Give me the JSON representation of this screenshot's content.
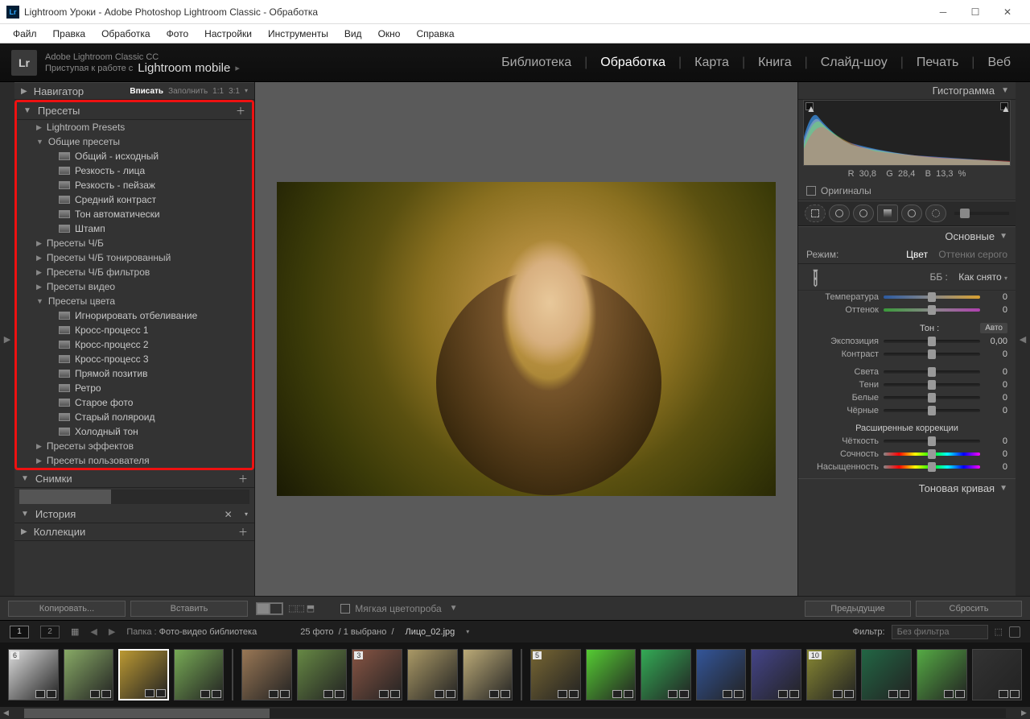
{
  "window": {
    "title": "Lightroom Уроки - Adobe Photoshop Lightroom Classic - Обработка"
  },
  "menu": [
    "Файл",
    "Правка",
    "Обработка",
    "Фото",
    "Настройки",
    "Инструменты",
    "Вид",
    "Окно",
    "Справка"
  ],
  "identity": {
    "line1": "Adobe Lightroom Classic CC",
    "line2a": "Приступая к работе с",
    "line2b": "Lightroom mobile"
  },
  "modules": [
    "Библиотека",
    "Обработка",
    "Карта",
    "Книга",
    "Слайд-шоу",
    "Печать",
    "Веб"
  ],
  "active_module": "Обработка",
  "left": {
    "navigator": {
      "title": "Навигатор",
      "fit": "Вписать",
      "fill": "Заполнить",
      "z1": "1:1",
      "z3": "3:1"
    },
    "presets": {
      "title": "Пресеты",
      "groups": [
        {
          "title": "Lightroom Presets",
          "expanded": false
        },
        {
          "title": "Общие пресеты",
          "expanded": true,
          "items": [
            "Общий - исходный",
            "Резкость - лица",
            "Резкость - пейзаж",
            "Средний контраст",
            "Тон автоматически",
            "Штамп"
          ]
        },
        {
          "title": "Пресеты Ч/Б",
          "expanded": false
        },
        {
          "title": "Пресеты Ч/Б тонированный",
          "expanded": false
        },
        {
          "title": "Пресеты Ч/Б фильтров",
          "expanded": false
        },
        {
          "title": "Пресеты видео",
          "expanded": false
        },
        {
          "title": "Пресеты цвета",
          "expanded": true,
          "items": [
            "Игнорировать отбеливание",
            "Кросс-процесс 1",
            "Кросс-процесс 2",
            "Кросс-процесс 3",
            "Прямой позитив",
            "Ретро",
            "Старое фото",
            "Старый поляроид",
            "Холодный тон"
          ]
        },
        {
          "title": "Пресеты эффектов",
          "expanded": false
        },
        {
          "title": "Пресеты пользователя",
          "expanded": false
        }
      ]
    },
    "snapshots": "Снимки",
    "history": "История",
    "collections": "Коллекции"
  },
  "right": {
    "histogram": "Гистограмма",
    "rgb": {
      "r_label": "R",
      "r": "30,8",
      "g_label": "G",
      "g": "28,4",
      "b_label": "B",
      "b": "13,3",
      "pct": "%"
    },
    "originals": "Оригиналы",
    "basic": {
      "title": "Основные",
      "mode_label": "Режим:",
      "mode_color": "Цвет",
      "mode_gray": "Оттенки серого",
      "wb_label": "ББ :",
      "wb_value": "Как снято",
      "temp": "Температура",
      "tint": "Оттенок",
      "tone": "Тон :",
      "auto": "Авто",
      "exposure": "Экспозиция",
      "contrast": "Контраст",
      "highlights": "Света",
      "shadows": "Тени",
      "whites": "Белые",
      "blacks": "Чёрные",
      "presence": "Расширенные коррекции",
      "clarity": "Чёткость",
      "vibrance": "Сочность",
      "saturation": "Насыщенность",
      "exposure_val": "0,00",
      "zero": "0"
    },
    "tone_curve": "Тоновая кривая"
  },
  "toolbar": {
    "copy": "Копировать...",
    "paste": "Вставить",
    "softproof": "Мягкая цветопроба",
    "prev": "Предыдущие",
    "reset": "Сбросить"
  },
  "filmstrip": {
    "folder_label": "Папка :",
    "folder": "Фото-видео библиотека",
    "count": "25 фото",
    "selected": "1 выбрано",
    "filename": "Лицо_02.jpg",
    "filter_label": "Фильтр:",
    "filter_value": "Без фильтра",
    "screen1": "1",
    "screen2": "2",
    "thumbs": [
      6,
      null,
      null,
      null,
      null,
      null,
      3,
      null,
      null,
      5,
      null,
      null,
      null,
      null,
      10,
      null,
      null,
      null
    ]
  }
}
